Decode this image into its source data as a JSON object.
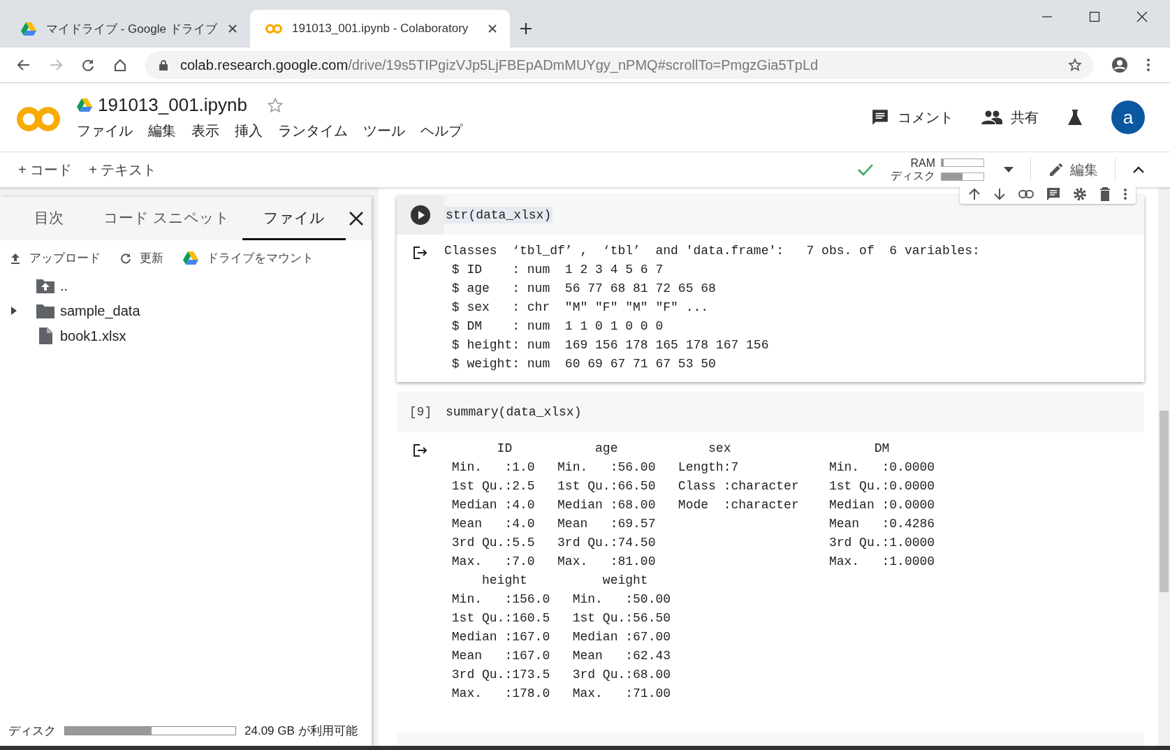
{
  "browser": {
    "tabs": [
      {
        "title": "マイドライブ - Google ドライブ",
        "kind": "drive",
        "selected": false
      },
      {
        "title": "191013_001.ipynb - Colaboratory",
        "kind": "colab",
        "selected": true
      }
    ],
    "url": {
      "host": "colab.research.google.com",
      "path": "/drive/19s5TIPgizVJp5LjFBEpADmMUYgy_nPMQ#scrollTo=PmgzGia5TpLd"
    }
  },
  "notebook": {
    "title": "191013_001.ipynb",
    "starred": false,
    "menu": [
      "ファイル",
      "編集",
      "表示",
      "挿入",
      "ランタイム",
      "ツール",
      "ヘルプ"
    ],
    "actions": [
      {
        "label": "コメント",
        "kind": "comment"
      },
      {
        "label": "共有",
        "kind": "share"
      }
    ],
    "avatar": "a"
  },
  "toolbar": {
    "add_buttons": [
      "+ コード",
      "+ テキスト"
    ],
    "connected": true,
    "resources": [
      {
        "label": "RAM",
        "level": 0.05
      },
      {
        "label": "ディスク",
        "level": 0.5
      }
    ],
    "edit": "編集"
  },
  "sidebar": {
    "tabs": [
      {
        "label": "目次",
        "selected": false
      },
      {
        "label": "コード スニペット",
        "selected": false
      },
      {
        "label": "ファイル",
        "selected": true
      }
    ],
    "actions": [
      {
        "label": "アップロード",
        "kind": "upload"
      },
      {
        "label": "更新",
        "kind": "refresh"
      },
      {
        "label": "ドライブをマウント",
        "kind": "drive"
      }
    ],
    "files": [
      {
        "name": "..",
        "kind": "parent"
      },
      {
        "name": "sample_data",
        "kind": "folder",
        "expanded": false
      },
      {
        "name": "book1.xlsx",
        "kind": "file"
      }
    ],
    "disk": {
      "label": "ディスク",
      "level": 0.51,
      "free": "24.09 GB が利用可能"
    }
  },
  "cells": [
    {
      "focused": true,
      "source": "str(data_xlsx)",
      "output": [
        "Classes  ‘tbl_df’ ,  ‘tbl’  and 'data.frame':   7 obs. of  6 variables:",
        " $ ID    : num  1 2 3 4 5 6 7",
        " $ age   : num  56 77 68 81 72 65 68",
        " $ sex   : chr  ″M″ ″F″ ″M″ ″F″ ...",
        " $ DM    : num  1 1 0 1 0 0 0",
        " $ height: num  169 156 178 165 178 167 156",
        " $ weight: num  60 69 67 71 67 53 50"
      ]
    },
    {
      "focused": false,
      "count": "[9]",
      "source": "summary(data_xlsx)",
      "output": [
        "       ID           age            sex                   DM",
        " Min.   :1.0   Min.   :56.00   Length:7            Min.   :0.0000",
        " 1st Qu.:2.5   1st Qu.:66.50   Class :character    1st Qu.:0.0000",
        " Median :4.0   Median :68.00   Mode  :character    Median :0.0000",
        " Mean   :4.0   Mean   :69.57                       Mean   :0.4286",
        " 3rd Qu.:5.5   3rd Qu.:74.50                       3rd Qu.:1.0000",
        " Max.   :7.0   Max.   :81.00                       Max.   :1.0000",
        "     height          weight",
        " Min.   :156.0   Min.   :50.00",
        " 1st Qu.:160.5   1st Qu.:56.50",
        " Median :167.0   Median :67.00",
        " Mean   :167.0   Mean   :62.43",
        " 3rd Qu.:173.5   3rd Qu.:68.00",
        " Max.   :178.0   Max.   :71.00"
      ]
    }
  ]
}
